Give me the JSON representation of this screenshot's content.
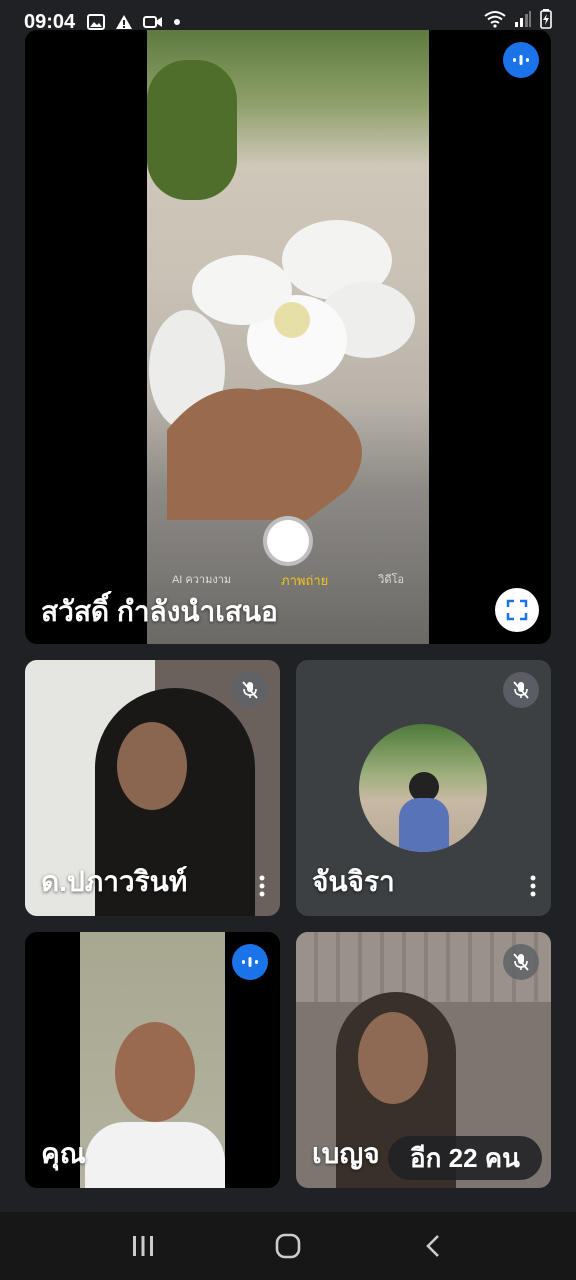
{
  "status_bar": {
    "time": "09:04",
    "left_icons": [
      "image-icon",
      "warning-icon",
      "video-icon",
      "dot-icon"
    ],
    "right_icons": [
      "wifi-icon",
      "signal-icon",
      "battery-icon"
    ]
  },
  "presenter": {
    "label": "สวัสดิ์ กำลังนำเสนอ",
    "camera_modes": [
      "ภาพถ่าย",
      "AI ความงาม",
      "วิดีโอ"
    ],
    "speaking": true
  },
  "participants": [
    {
      "name": "ด.ปภาวรินท์",
      "mic_muted": true
    },
    {
      "name": "จันจิรา",
      "mic_muted": true
    },
    {
      "name": "คุณ",
      "mic_muted": false,
      "speaking": true
    },
    {
      "name": "เบญจ",
      "mic_muted": true
    }
  ],
  "more_participants": "อีก 22 คน",
  "nav": [
    "recents-button",
    "home-button",
    "back-button"
  ]
}
